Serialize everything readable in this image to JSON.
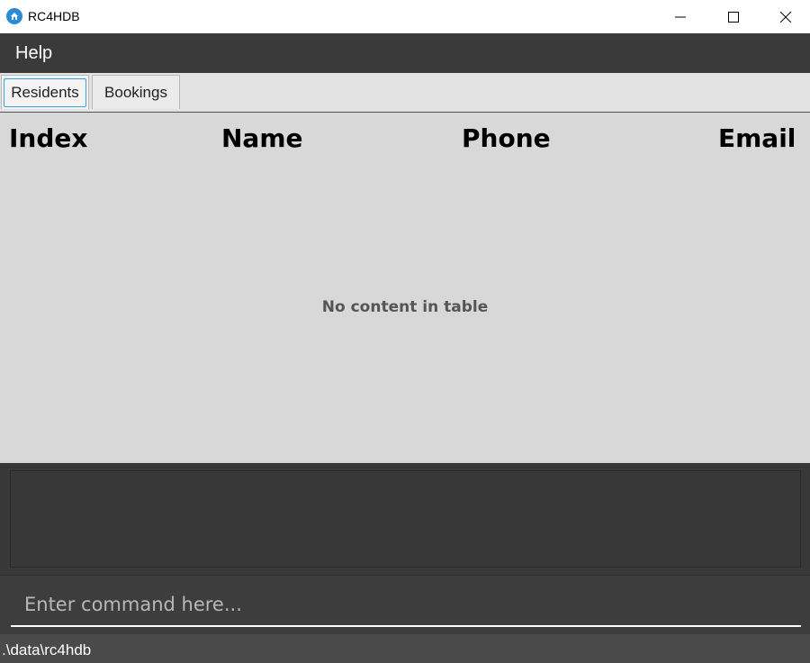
{
  "window": {
    "title": "RC4HDB",
    "accent": "#2a8ad4",
    "icon": "home-icon"
  },
  "menu": {
    "items": [
      {
        "label": "Help"
      }
    ]
  },
  "tabs": [
    {
      "label": "Residents",
      "selected": true
    },
    {
      "label": "Bookings",
      "selected": false
    }
  ],
  "table": {
    "columns": [
      "Index",
      "Name",
      "Phone",
      "Email"
    ],
    "rows": [],
    "empty_message": "No content in table"
  },
  "result_display": {
    "text": ""
  },
  "command": {
    "value": "",
    "placeholder": "Enter command here..."
  },
  "status": {
    "path": ".\\data\\rc4hdb"
  }
}
